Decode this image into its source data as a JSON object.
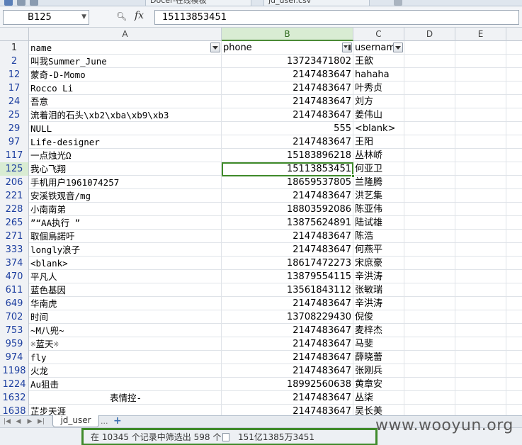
{
  "window_tabs": [
    {
      "label": "Docer-在线模板"
    },
    {
      "label": "jd_user.csv"
    }
  ],
  "formula_bar": {
    "cell_ref": "B125",
    "fx_label": "fx",
    "value": "15113853451"
  },
  "columns": [
    "A",
    "B",
    "C",
    "D",
    "E"
  ],
  "header_row": {
    "row_num": "1",
    "name": "name",
    "phone": "phone",
    "username": "usernam"
  },
  "rows": [
    {
      "row_num": "2",
      "name": "叫我Summer_June",
      "phone": "13723471802",
      "username": "王歆"
    },
    {
      "row_num": "12",
      "name": "蒙奇-D-Momo",
      "phone": "2147483647",
      "username": "hahaha"
    },
    {
      "row_num": "17",
      "name": "Rocco Li",
      "phone": "2147483647",
      "username": "叶秀贞"
    },
    {
      "row_num": "24",
      "name": "吾意",
      "phone": "2147483647",
      "username": "刘方"
    },
    {
      "row_num": "25",
      "name": "流着泪的石头\\xb2\\xba\\xb9\\xb3",
      "phone": "2147483647",
      "username": "姜伟山"
    },
    {
      "row_num": "29",
      "name": "NULL",
      "phone": "555",
      "username": "<blank>"
    },
    {
      "row_num": "97",
      "name": "Life-designer",
      "phone": "2147483647",
      "username": "王阳"
    },
    {
      "row_num": "117",
      "name": "一点烛光Ω",
      "phone": "15183896218",
      "username": "丛林峤"
    },
    {
      "row_num": "125",
      "name": "我心飞翔",
      "phone": "15113853451",
      "username": "何亚卫"
    },
    {
      "row_num": "206",
      "name": "手机用户1961074257",
      "phone": "18659537805",
      "username": "兰隆腾"
    },
    {
      "row_num": "221",
      "name": "安溪铁观音/mg",
      "phone": "2147483647",
      "username": "洪艺集"
    },
    {
      "row_num": "228",
      "name": "小南南弟",
      "phone": "18803592086",
      "username": "陈亚伟"
    },
    {
      "row_num": "265",
      "name": "”“AA执行 ”",
      "phone": "13875624891",
      "username": "陆试雄"
    },
    {
      "row_num": "271",
      "name": " 取個鳥諾吁",
      "phone": "2147483647",
      "username": "陈浩"
    },
    {
      "row_num": "333",
      "name": "longly浪子",
      "phone": "2147483647",
      "username": "何燕平"
    },
    {
      "row_num": "374",
      "name": "<blank>",
      "phone": "18617472273",
      "username": "宋庶豪"
    },
    {
      "row_num": "470",
      "name": "平凡人",
      "phone": "13879554115",
      "username": "辛洪涛"
    },
    {
      "row_num": "611",
      "name": "蓝色基因",
      "phone": "13561843112",
      "username": "张敏瑞"
    },
    {
      "row_num": "649",
      "name": "华南虎",
      "phone": "2147483647",
      "username": "辛洪涛"
    },
    {
      "row_num": "702",
      "name": "时间",
      "phone": "13708229430",
      "username": "倪俊"
    },
    {
      "row_num": "753",
      "name": "~M八兜~",
      "phone": "2147483647",
      "username": "麦梓杰"
    },
    {
      "row_num": "959",
      "name": "☼蓝天☼",
      "phone": "2147483647",
      "username": "马斐"
    },
    {
      "row_num": "974",
      "name": "fly",
      "phone": "2147483647",
      "username": "薛晓蕾"
    },
    {
      "row_num": "1198",
      "name": "火龙",
      "phone": "2147483647",
      "username": "张刚兵"
    },
    {
      "row_num": "1224",
      "name": "Au狙击",
      "phone": "18992560638",
      "username": "黄章安"
    },
    {
      "row_num": "1632",
      "name": "表情控-",
      "phone": "2147483647",
      "username": "丛柒"
    },
    {
      "row_num": "1638",
      "name": "芷步天涯",
      "phone": "2147483647",
      "username": "吴长美"
    }
  ],
  "sheet_tabs": {
    "active": "jd_user",
    "more": "...",
    "add": "+"
  },
  "status_bar": {
    "filter_text": "在 10345 个记录中筛选出 598 个",
    "sum_text": "151亿1385万3451"
  },
  "watermark": "www.wooyun.org",
  "colors": {
    "selection_green": "#3f8a2a",
    "row_number_blue": "#1d3fa0"
  }
}
